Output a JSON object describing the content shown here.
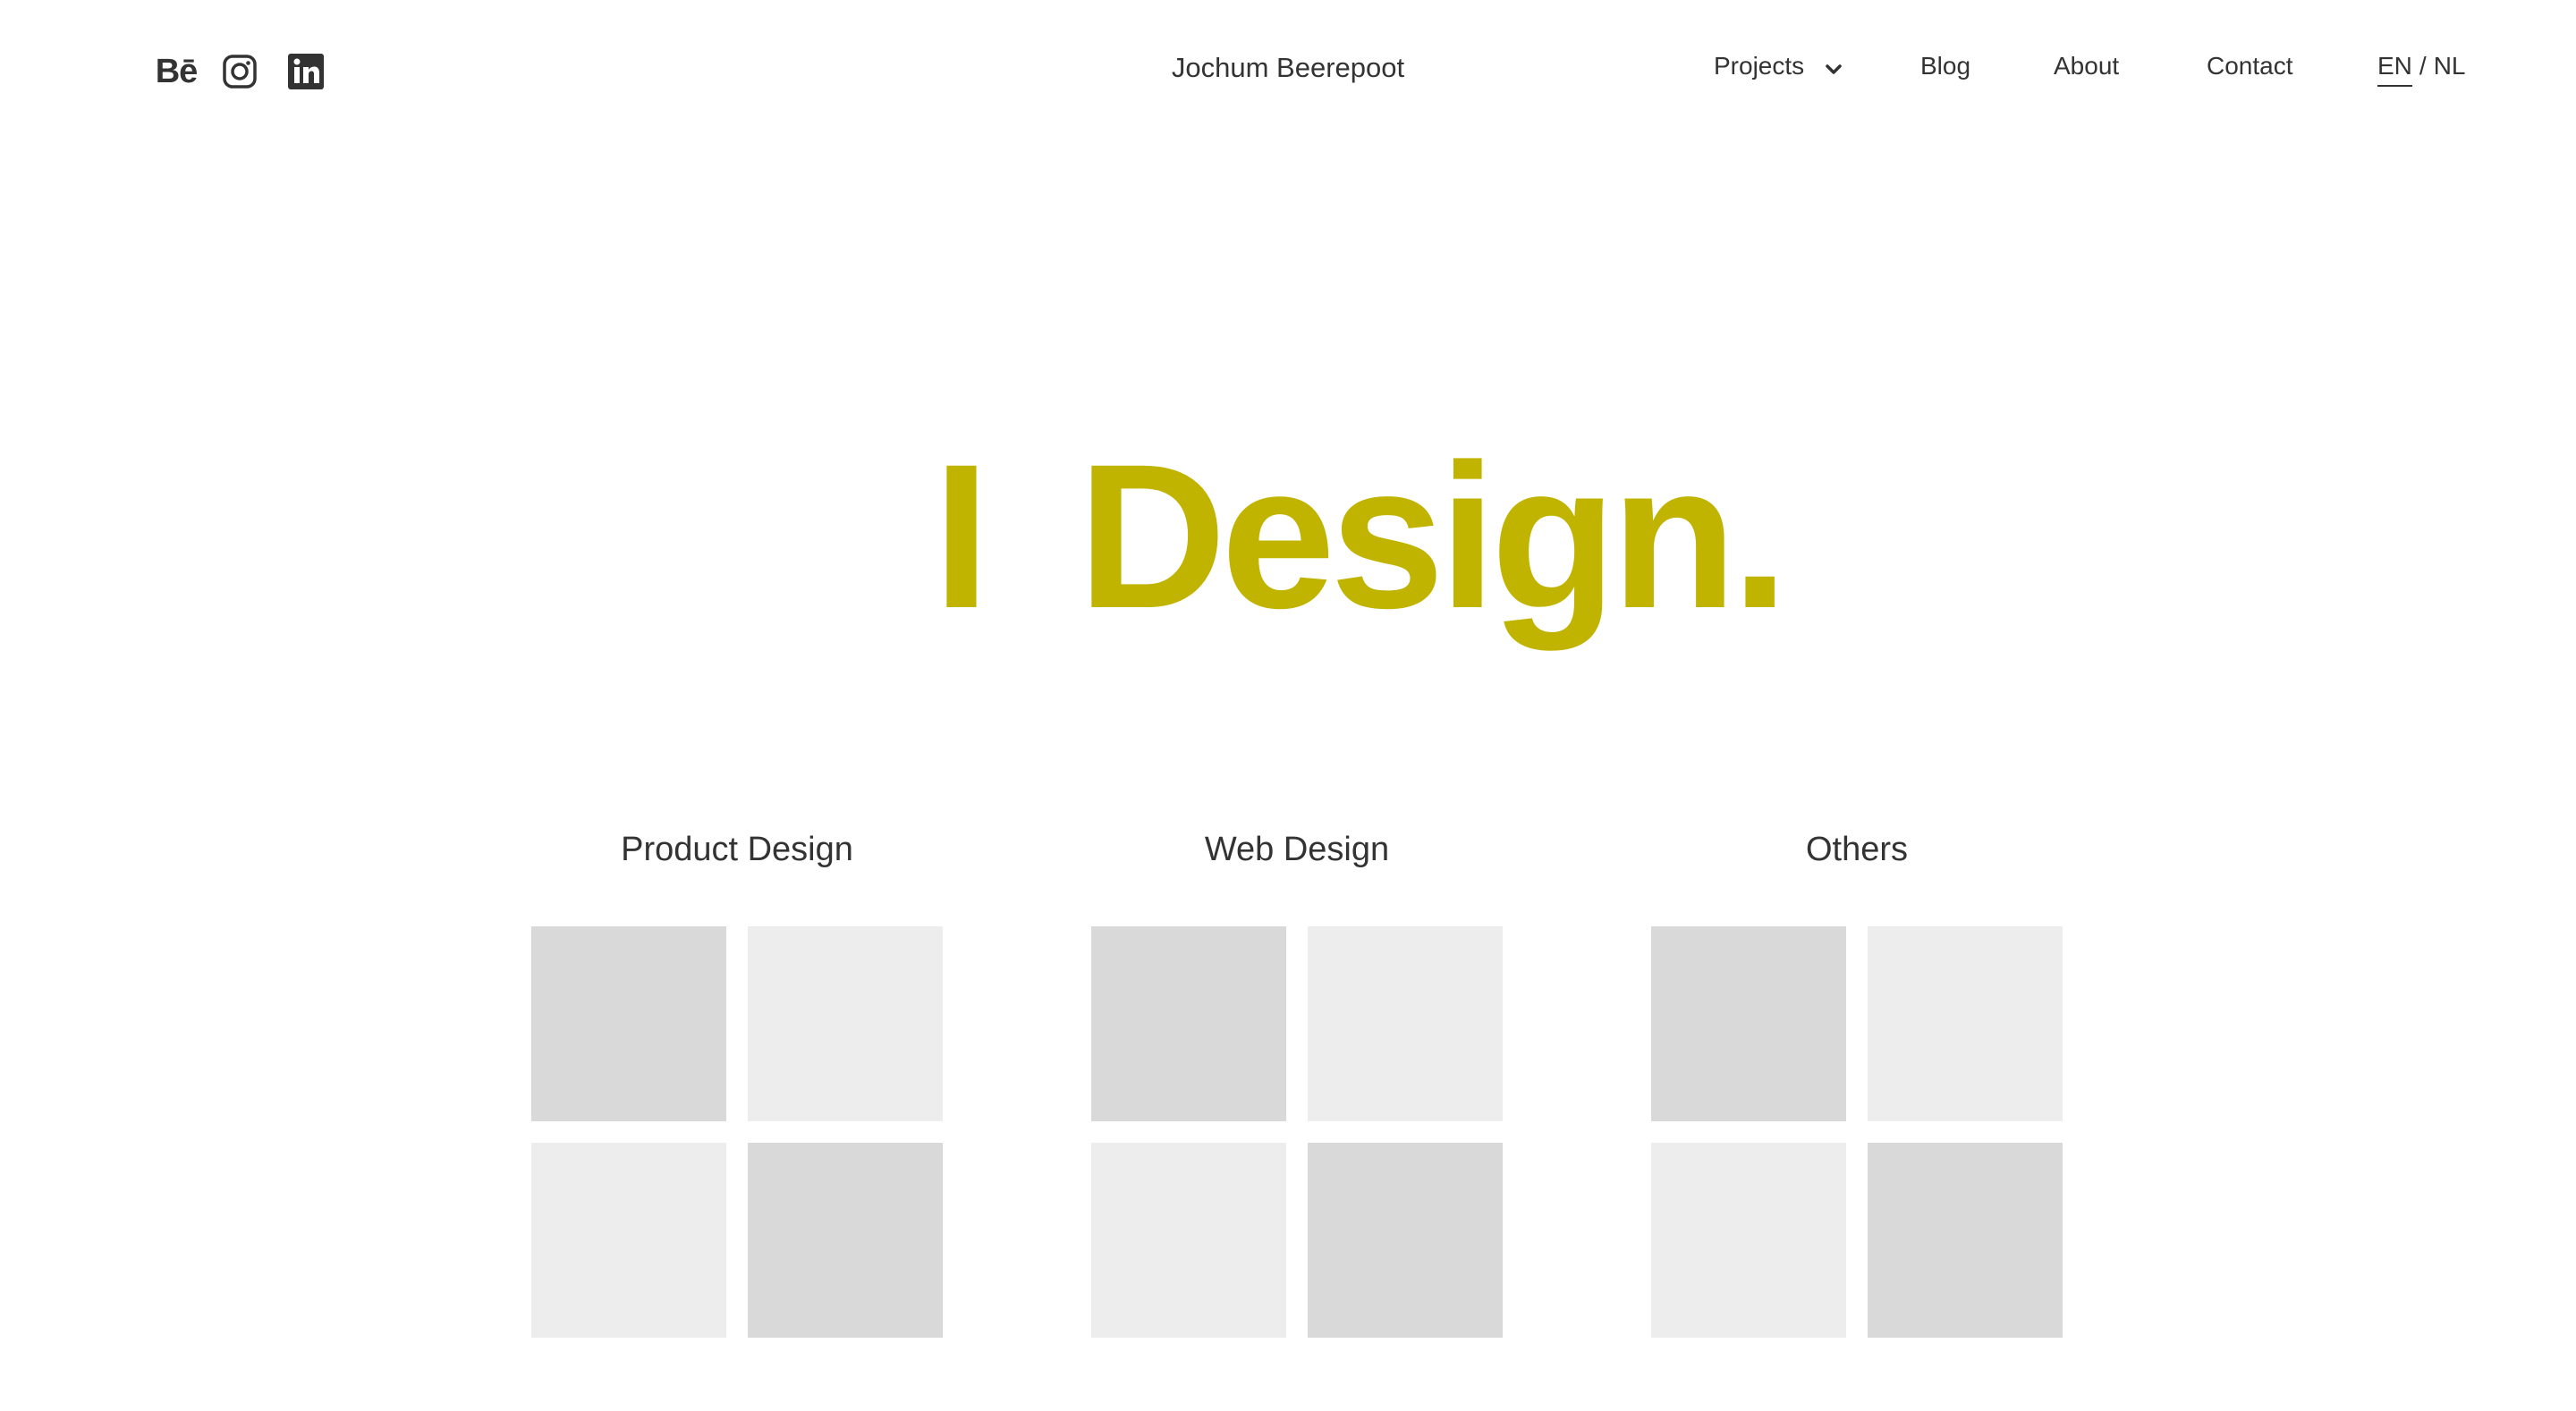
{
  "header": {
    "site_name": "Jochum Beerepoot",
    "social": {
      "behance_label": "Bē",
      "icons": [
        "behance-icon",
        "instagram-icon",
        "linkedin-icon"
      ]
    },
    "nav": {
      "projects": "Projects",
      "blog": "Blog",
      "about": "About",
      "contact": "Contact"
    },
    "language": {
      "active": "EN",
      "separator": "/",
      "other": "NL"
    }
  },
  "hero": {
    "subject": "I",
    "headline": "Design."
  },
  "categories": [
    {
      "title": "Product Design"
    },
    {
      "title": "Web Design"
    },
    {
      "title": "Others"
    }
  ],
  "colors": {
    "accent": "#c0b400",
    "text": "#333333",
    "tile_dark": "#d9d9d9",
    "tile_light": "#ededee",
    "background": "#ffffff"
  }
}
